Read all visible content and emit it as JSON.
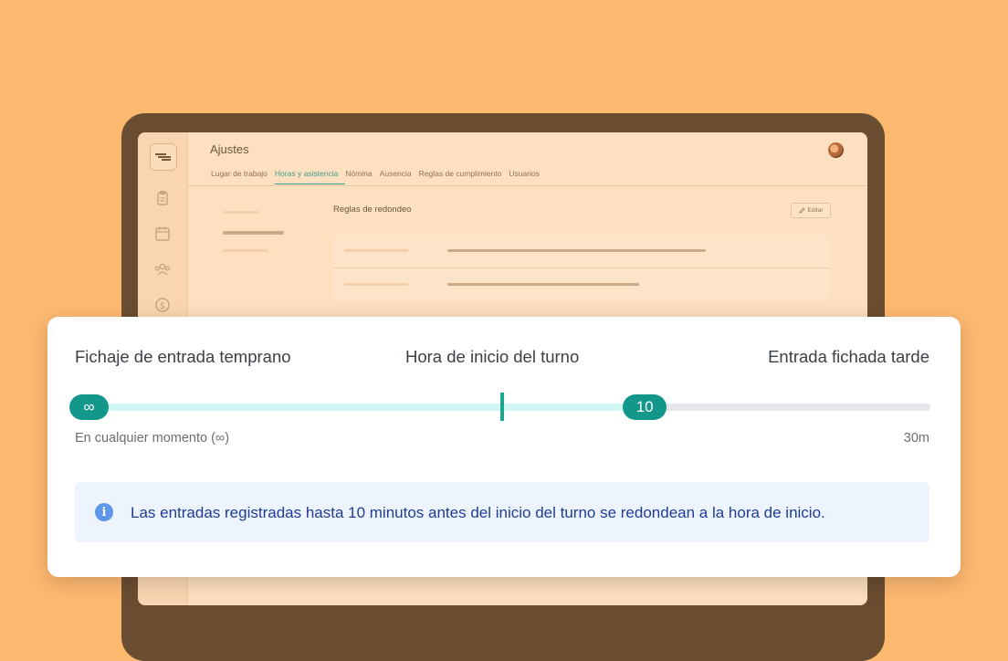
{
  "app": {
    "title": "Ajustes",
    "tabs": [
      {
        "label": "Lugar de trabajo",
        "active": false
      },
      {
        "label": "Horas y asistencia",
        "active": true
      },
      {
        "label": "Nómina",
        "active": false
      },
      {
        "label": "Ausencia",
        "active": false
      },
      {
        "label": "Reglas de cumplimiento",
        "active": false
      },
      {
        "label": "Usuarios",
        "active": false
      }
    ],
    "section_title": "Reglas de redondeo",
    "edit_label": "Editar",
    "sidebar_icons": [
      "logo-icon",
      "clipboard-icon",
      "calendar-icon",
      "people-icon",
      "dollar-icon"
    ]
  },
  "rounding": {
    "early_label": "Fichaje de entrada temprano",
    "start_label": "Hora de inicio del turno",
    "late_label": "Entrada fichada tarde",
    "early_value": "∞",
    "late_value": "10",
    "late_fill_fraction": 0.333,
    "early_caption": "En cualquier momento (∞)",
    "late_max": "30m",
    "info_text": "Las entradas registradas hasta 10 minutos antes del inicio del turno se redondean a la hora de inicio.",
    "info_icon": "info-icon"
  },
  "colors": {
    "background": "#FEB970",
    "accent": "#13978B",
    "track_fill": "#D1F7F4",
    "info_bg": "#EEF4FD",
    "info_text": "#1E3D92"
  }
}
